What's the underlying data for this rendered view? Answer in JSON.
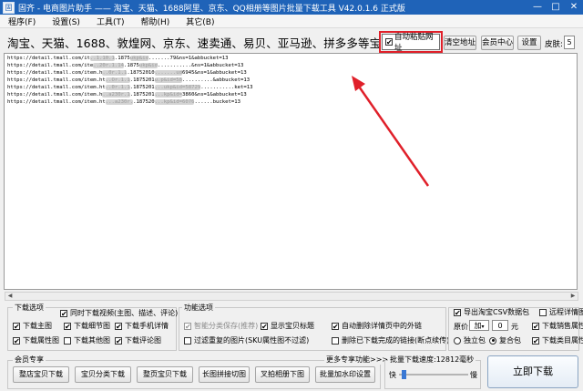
{
  "window": {
    "title": "固齐 - 电商图片助手 —— 淘宝、天猫、1688阿里、京东、QQ相册等图片批量下载工具 V42.0.1.6 正式版",
    "controls": [
      "—",
      "□",
      "✕"
    ]
  },
  "menu": [
    "程序(F)",
    "设置(S)",
    "工具(T)",
    "帮助(H)",
    "其它(B)"
  ],
  "urlbar": {
    "label": "淘宝、天猫、1688、敦煌网、京东、速卖通、易贝、亚马逊、拼多多等宝贝地址:",
    "auto_paste": "自动粘贴网址",
    "clear": "清空地址",
    "member": "会员中心",
    "settings": "设置",
    "skin_label": "皮肤:",
    "skin_value": "5"
  },
  "urls": [
    {
      "a": "https://detail.tmall.com/it",
      "b": "..1.10.1",
      "c": ".1875",
      "d": "ukp&id",
      "e": ".......79&ns=1&abbucket=13"
    },
    {
      "a": "https://detail.tmall.com/ite",
      "b": "..20r.1.14",
      "c": ".1875",
      "d": "ukp&id",
      "e": "...........&ns=1&abbucket=13"
    },
    {
      "a": "https://detail.tmall.com/item.h",
      "b": "..0r.1.1",
      "c": ".18752010",
      "d": ".......ud",
      "e": "6945&ns=1&abbucket=13"
    },
    {
      "a": "https://detail.tmall.com/item.ht",
      "b": "..Or.1.1",
      "c": ".1875201",
      "d": "u.p&id=58",
      "e": "..........&abbucket=13"
    },
    {
      "a": "https://detail.tmall.com/item.ht",
      "b": "..0r.1.1",
      "c": ".1875201",
      "d": "...ukp&id=58729",
      "e": "...........ket=13"
    },
    {
      "a": "https://detail.tmall.com/item.h",
      "b": "..a230r.1",
      "c": ".1875201",
      "d": "...kp&id=",
      "e": "3860&ns=1&abbucket=13"
    },
    {
      "a": "https://detail.tmall.com/item.ht",
      "b": "...a230r.",
      "c": ".187520",
      "d": "...kp&id=6076",
      "e": "......bucket=13"
    }
  ],
  "download_options": {
    "title": "下载选项",
    "items": [
      {
        "label": "同时下载视频(主图、描述、评论)",
        "checked": true
      },
      {
        "label": "下载主图",
        "checked": true
      },
      {
        "label": "下载细节图",
        "checked": true
      },
      {
        "label": "下载手机详情",
        "checked": true
      },
      {
        "label": "下载属性图",
        "checked": true
      },
      {
        "label": "下载其他图",
        "checked": false
      },
      {
        "label": "下载评论图",
        "checked": true
      }
    ]
  },
  "function_options": {
    "title": "功能选项",
    "items": [
      {
        "label": "智能分类保存(推荐)",
        "checked": true,
        "disabled": true
      },
      {
        "label": "显示宝贝标题",
        "checked": true
      },
      {
        "label": "自动删除详情页中的外链",
        "checked": true
      },
      {
        "label": "过滤重复的图片(SKU属性图不过滤)",
        "checked": false
      },
      {
        "label": "删除已下载完成的链接(断点续传)",
        "checked": false
      }
    ]
  },
  "csv_options": {
    "export_csv": {
      "label": "导出淘宝CSV数据包",
      "checked": true
    },
    "remote_detail": {
      "label": "远程详情图",
      "checked": false
    },
    "price_label": "原价",
    "price_op": "加",
    "price_value": "0",
    "price_unit": "元",
    "sales_attr": {
      "label": "下载销售属性",
      "checked": true
    },
    "radio_single": "独立包",
    "radio_combined": "复合包",
    "selected_radio": "复合包",
    "category_attr": {
      "label": "下载类目属性",
      "checked": true
    }
  },
  "member_tools": {
    "title": "会员专享",
    "more": "更多专享功能>>>",
    "buttons": [
      "整店宝贝下载",
      "宝贝分类下载",
      "整页宝贝下载",
      "长图拼接切图",
      "叉拍相册下图",
      "批量加水印设置"
    ]
  },
  "speed": {
    "label": "批量下载速度:",
    "value": "12812毫秒",
    "fast": "快",
    "slow": "慢",
    "level": 0.04
  },
  "start_button": "立即下载"
}
